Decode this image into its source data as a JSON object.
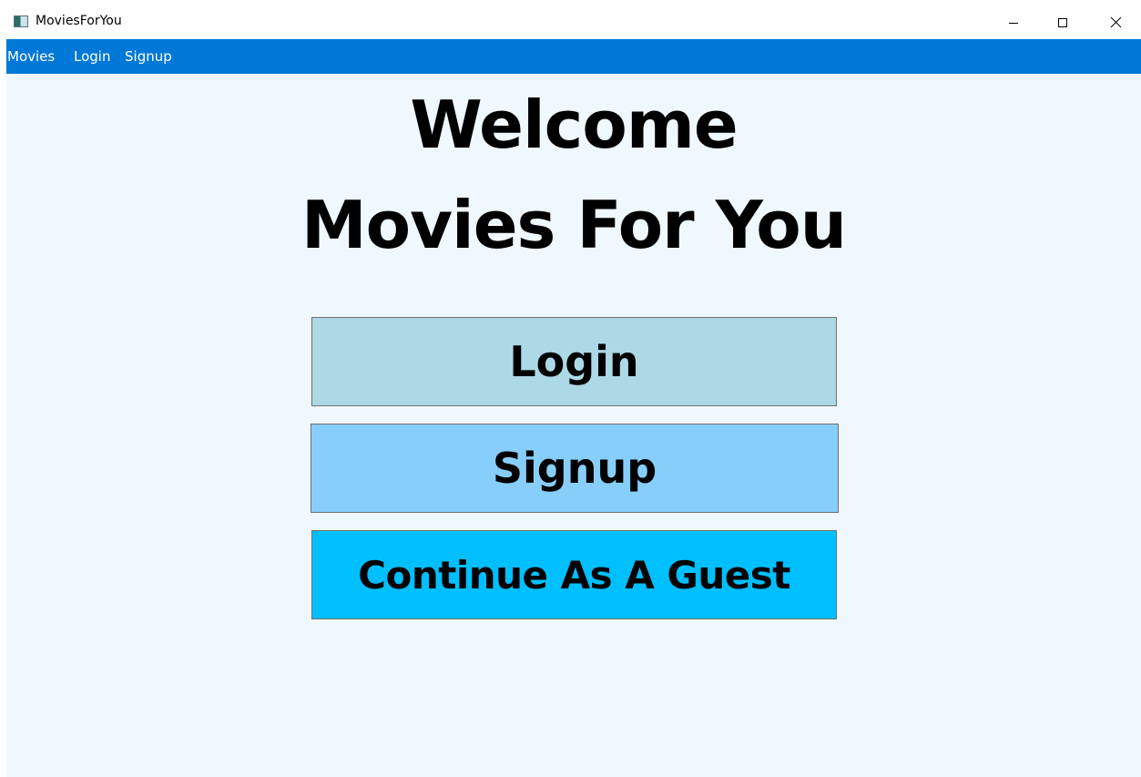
{
  "window": {
    "title": "MoviesForYou",
    "icon": "app-window-icon",
    "controls": {
      "minimize_icon": "minimize-icon",
      "maximize_icon": "maximize-icon",
      "close_icon": "close-icon"
    }
  },
  "menu": {
    "background": "#0078d7",
    "items": [
      {
        "label": "Movies"
      },
      {
        "label": "Login"
      },
      {
        "label": "Signup"
      }
    ]
  },
  "main": {
    "background": "#f0f8ff",
    "heading_line1": "Welcome",
    "heading_line2": "Movies For You",
    "buttons": {
      "login": {
        "label": "Login",
        "color": "#add8e6"
      },
      "signup": {
        "label": "Signup",
        "color": "#87cefa"
      },
      "guest": {
        "label": "Continue As A Guest",
        "color": "#00bfff"
      }
    }
  }
}
